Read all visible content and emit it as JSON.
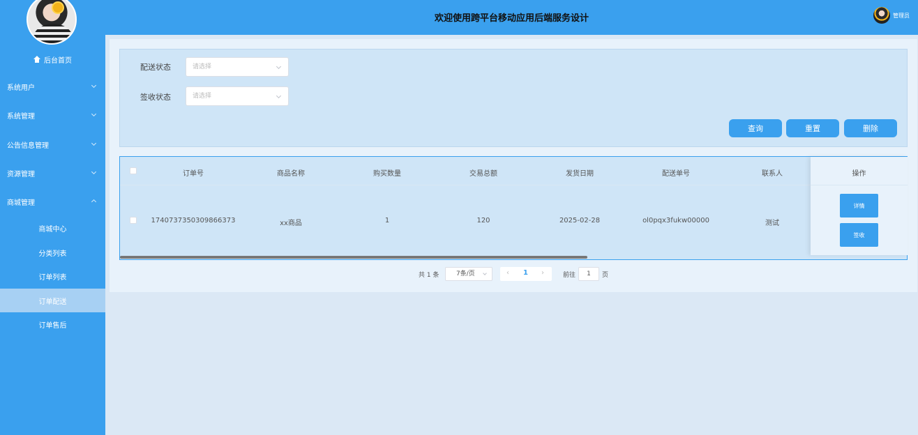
{
  "header": {
    "title": "欢迎使用跨平台移动应用后端服务设计",
    "admin_label": "管理员"
  },
  "sidebar": {
    "home": "后台首页",
    "groups": [
      {
        "label": "系统用户"
      },
      {
        "label": "系统管理"
      },
      {
        "label": "公告信息管理"
      },
      {
        "label": "资源管理"
      },
      {
        "label": "商城管理"
      }
    ],
    "sub_items": [
      {
        "label": "商城中心"
      },
      {
        "label": "分类列表"
      },
      {
        "label": "订单列表"
      },
      {
        "label": "订单配送",
        "active": true
      },
      {
        "label": "订单售后"
      }
    ]
  },
  "filters": {
    "delivery_status": {
      "label": "配送状态",
      "placeholder": "请选择"
    },
    "receipt_status": {
      "label": "签收状态",
      "placeholder": "请选择"
    }
  },
  "buttons": {
    "query": "查询",
    "reset": "重置",
    "delete": "删除"
  },
  "table": {
    "columns": [
      "订单号",
      "商品名称",
      "购买数量",
      "交易总额",
      "发货日期",
      "配送单号",
      "联系人",
      "操作"
    ],
    "rows": [
      {
        "order_no": "1740737350309866373",
        "product": "xx商品",
        "qty": "1",
        "total": "120",
        "ship_date": "2025-02-28",
        "delivery_no": "ol0pqx3fukw00000",
        "contact": "测试",
        "ops": [
          "详情",
          "签收"
        ]
      }
    ]
  },
  "pagination": {
    "total": "共 1 条",
    "page_size": "7条/页",
    "current": "1",
    "goto_label": "前往",
    "goto_value": "1",
    "page_suffix": "页"
  },
  "colors": {
    "primary": "#3aa0ee",
    "active_menu": "#a7d0f3"
  }
}
